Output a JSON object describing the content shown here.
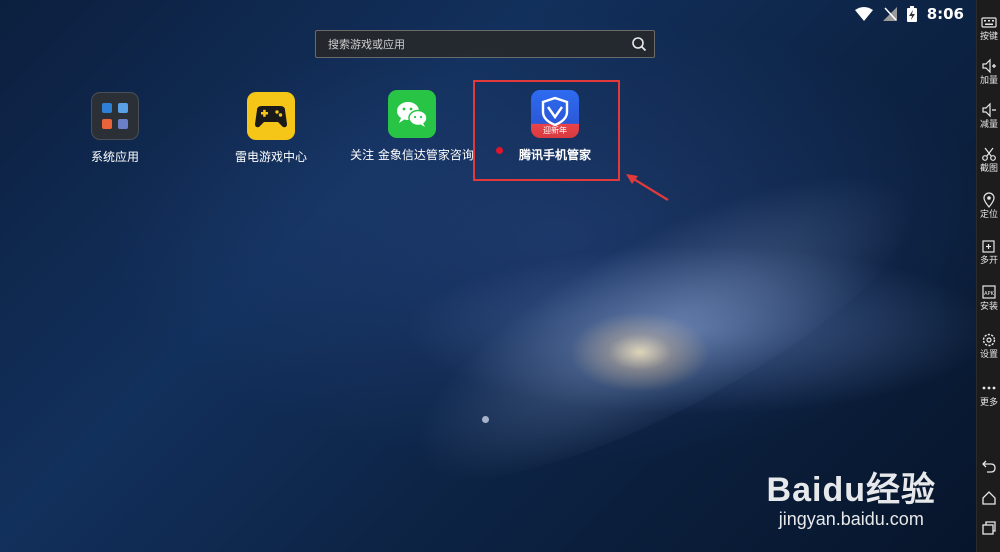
{
  "status_bar": {
    "time": "8:06"
  },
  "search": {
    "placeholder": "搜索游戏或应用"
  },
  "apps": [
    {
      "label": "系统应用",
      "icon": "system-apps-folder-icon"
    },
    {
      "label": "雷电游戏中心",
      "icon": "gamepad-icon"
    },
    {
      "label": "关注 金象信达管家咨询",
      "icon": "wechat-icon"
    },
    {
      "label": "腾讯手机管家",
      "icon": "tencent-shield-icon",
      "badge_text": "迎新年"
    }
  ],
  "sidebar": {
    "items": [
      {
        "label": "按键",
        "icon": "keyboard-icon"
      },
      {
        "label": "加量",
        "icon": "volume-up-icon"
      },
      {
        "label": "减量",
        "icon": "volume-down-icon"
      },
      {
        "label": "截图",
        "icon": "scissors-icon"
      },
      {
        "label": "定位",
        "icon": "location-pin-icon"
      },
      {
        "label": "多开",
        "icon": "multi-open-icon"
      },
      {
        "label": "安装",
        "icon": "apk-install-icon",
        "icon_text": "APK"
      },
      {
        "label": "设置",
        "icon": "gear-icon"
      },
      {
        "label": "更多",
        "icon": "more-dots-icon"
      }
    ],
    "nav": [
      "back-icon",
      "home-icon",
      "recents-icon"
    ]
  },
  "watermark": {
    "brand": "Baidu经验",
    "url": "jingyan.baidu.com"
  },
  "colors": {
    "highlight": "#e23a3a",
    "sidebar_bg": "#1c1c1c",
    "wechat": "#28c445",
    "leidian": "#f5c518"
  }
}
